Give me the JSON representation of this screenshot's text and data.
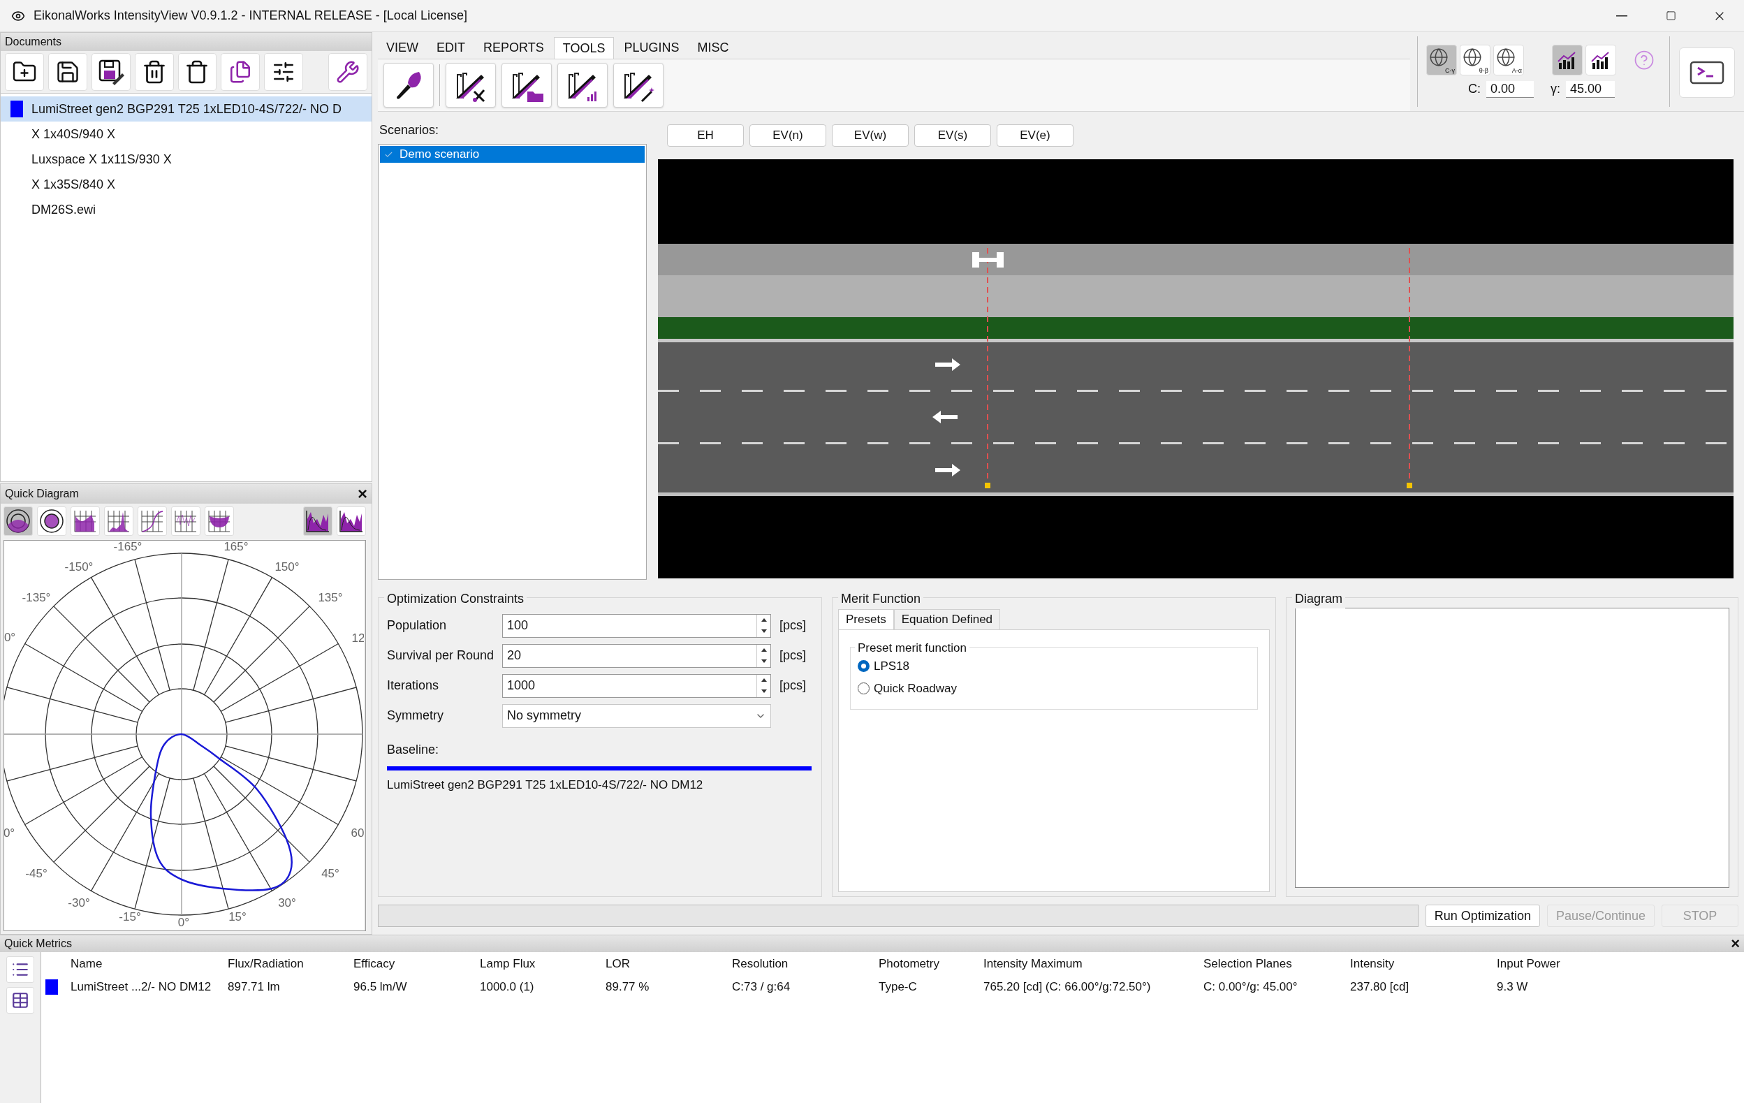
{
  "window": {
    "title": "EikonalWorks IntensityView V0.9.1.2 - INTERNAL RELEASE - [Local License]"
  },
  "documents": {
    "title": "Documents",
    "items": [
      {
        "label": "LumiStreet gen2 BGP291 T25 1xLED10-4S/722/- NO D",
        "selected": true,
        "color": "#0000ff"
      },
      {
        "label": "X 1x40S/940 X",
        "selected": false
      },
      {
        "label": "Luxspace X 1x11S/930 X",
        "selected": false
      },
      {
        "label": "X 1x35S/840 X",
        "selected": false
      },
      {
        "label": "DM26S.ewi",
        "selected": false
      }
    ]
  },
  "quick_diagram": {
    "title": "Quick Diagram",
    "close": "×",
    "chart_types": [
      {
        "selected": true
      },
      {
        "selected": false
      },
      {
        "selected": false
      },
      {
        "selected": false
      },
      {
        "selected": false
      },
      {
        "selected": false
      },
      {
        "selected": false
      }
    ],
    "modes": [
      {
        "selected": true
      },
      {
        "selected": false
      }
    ],
    "angle_labels": [
      "-165°",
      "165°",
      "-150°",
      "150°",
      "-135°",
      "135°",
      "0°",
      "12",
      "0°",
      "60",
      "-45°",
      "45°",
      "-30°",
      "30°",
      "-15°",
      "15°",
      "0°"
    ]
  },
  "menu_tabs": [
    {
      "label": "VIEW",
      "selected": false
    },
    {
      "label": "EDIT",
      "selected": false
    },
    {
      "label": "REPORTS",
      "selected": false
    },
    {
      "label": "TOOLS",
      "selected": true
    },
    {
      "label": "PLUGINS",
      "selected": false
    },
    {
      "label": "MISC",
      "selected": false
    }
  ],
  "view_options": {
    "coordinate_systems": [
      {
        "label": "C-γ",
        "selected": true
      },
      {
        "label": "θ-β",
        "selected": false
      },
      {
        "label": "A-α",
        "selected": false
      }
    ],
    "chart_modes": [
      {
        "selected": true
      },
      {
        "selected": false
      }
    ],
    "c_label": "C:",
    "c_value": "0.00",
    "gamma_label": "γ:",
    "gamma_value": "45.00"
  },
  "scenarios": {
    "label": "Scenarios:",
    "items": [
      {
        "label": "Demo scenario",
        "selected": true,
        "checked": true
      }
    ]
  },
  "view_buttons": [
    "EH",
    "EV(n)",
    "EV(w)",
    "EV(s)",
    "EV(e)"
  ],
  "optimization_constraints": {
    "title": "Optimization Constraints",
    "fields": [
      {
        "label": "Population",
        "value": "100",
        "unit": "[pcs]",
        "kind": "spinner"
      },
      {
        "label": "Survival per Round",
        "value": "20",
        "unit": "[pcs]",
        "kind": "spinner"
      },
      {
        "label": "Iterations",
        "value": "1000",
        "unit": "[pcs]",
        "kind": "spinner"
      },
      {
        "label": "Symmetry",
        "value": "No symmetry",
        "kind": "dropdown"
      }
    ],
    "baseline_label": "Baseline:",
    "baseline_name": "LumiStreet gen2 BGP291 T25 1xLED10-4S/722/- NO DM12"
  },
  "merit_function": {
    "title": "Merit Function",
    "tabs": [
      {
        "label": "Presets",
        "selected": true
      },
      {
        "label": "Equation Defined",
        "selected": false
      }
    ],
    "group_title": "Preset merit function",
    "options": [
      {
        "label": "LPS18",
        "selected": true
      },
      {
        "label": "Quick Roadway",
        "selected": false
      }
    ]
  },
  "diagram": {
    "title": "Diagram"
  },
  "actions": [
    {
      "label": "Run Optimization",
      "disabled": false
    },
    {
      "label": "Pause/Continue",
      "disabled": true
    },
    {
      "label": "STOP",
      "disabled": true
    }
  ],
  "quick_metrics": {
    "title": "Quick Metrics",
    "close": "×",
    "columns": [
      "Name",
      "Flux/Radiation",
      "Efficacy",
      "Lamp Flux",
      "LOR",
      "Resolution",
      "Photometry",
      "Intensity Maximum",
      "Selection Planes",
      "Intensity",
      "Input Power"
    ],
    "rows": [
      {
        "color": "#0000ff",
        "cells": [
          "LumiStreet ...2/- NO DM12",
          "897.71 lm",
          "96.5 lm/W",
          "1000.0 (1)",
          "89.77 %",
          "C:73 / g:64",
          "Type-C",
          "765.20 [cd] (C: 66.00°/g:72.50°)",
          "C: 0.00°/g: 45.00°",
          "237.80 [cd]",
          "9.3 W"
        ]
      }
    ]
  }
}
